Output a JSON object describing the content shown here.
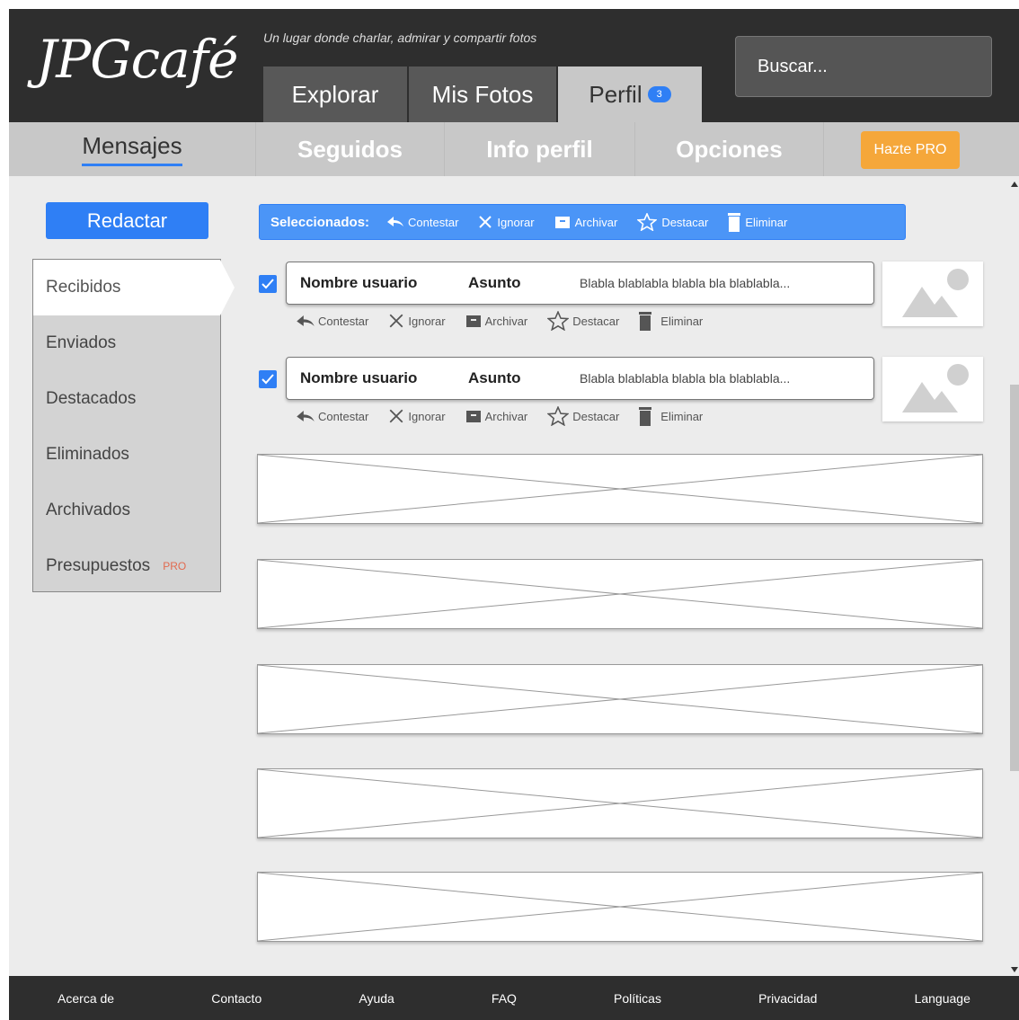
{
  "header": {
    "logo": "JPGcafé",
    "tagline": "Un lugar donde charlar, admirar y compartir fotos",
    "search_placeholder": "Buscar...",
    "tabs": [
      {
        "label": "Explorar"
      },
      {
        "label": "Mis Fotos"
      },
      {
        "label": "Perfil",
        "badge": "3"
      }
    ]
  },
  "subnav": {
    "items": [
      "Mensajes",
      "Seguidos",
      "Info perfil",
      "Opciones"
    ],
    "pro_button": "Hazte PRO"
  },
  "sidebar": {
    "compose": "Redactar",
    "items": [
      "Recibidos",
      "Enviados",
      "Destacados",
      "Eliminados",
      "Archivados",
      "Presupuestos"
    ],
    "pro_tag": "PRO"
  },
  "toolbar": {
    "label": "Seleccionados:",
    "actions": [
      "Contestar",
      "Ignorar",
      "Archivar",
      "Destacar",
      "Eliminar"
    ]
  },
  "messages": [
    {
      "user": "Nombre usuario",
      "subject": "Asunto",
      "preview": "Blabla blablabla blabla bla blablabla...",
      "checked": true
    },
    {
      "user": "Nombre usuario",
      "subject": "Asunto",
      "preview": "Blabla blablabla blabla bla blablabla...",
      "checked": true
    }
  ],
  "row_actions": [
    "Contestar",
    "Ignorar",
    "Archivar",
    "Destacar",
    "Eliminar"
  ],
  "footer": [
    "Acerca de",
    "Contacto",
    "Ayuda",
    "FAQ",
    "Políticas",
    "Privacidad",
    "Language"
  ],
  "colors": {
    "accent": "#2f7ff5",
    "pro": "#f5a73a",
    "header": "#2e2e2e"
  }
}
